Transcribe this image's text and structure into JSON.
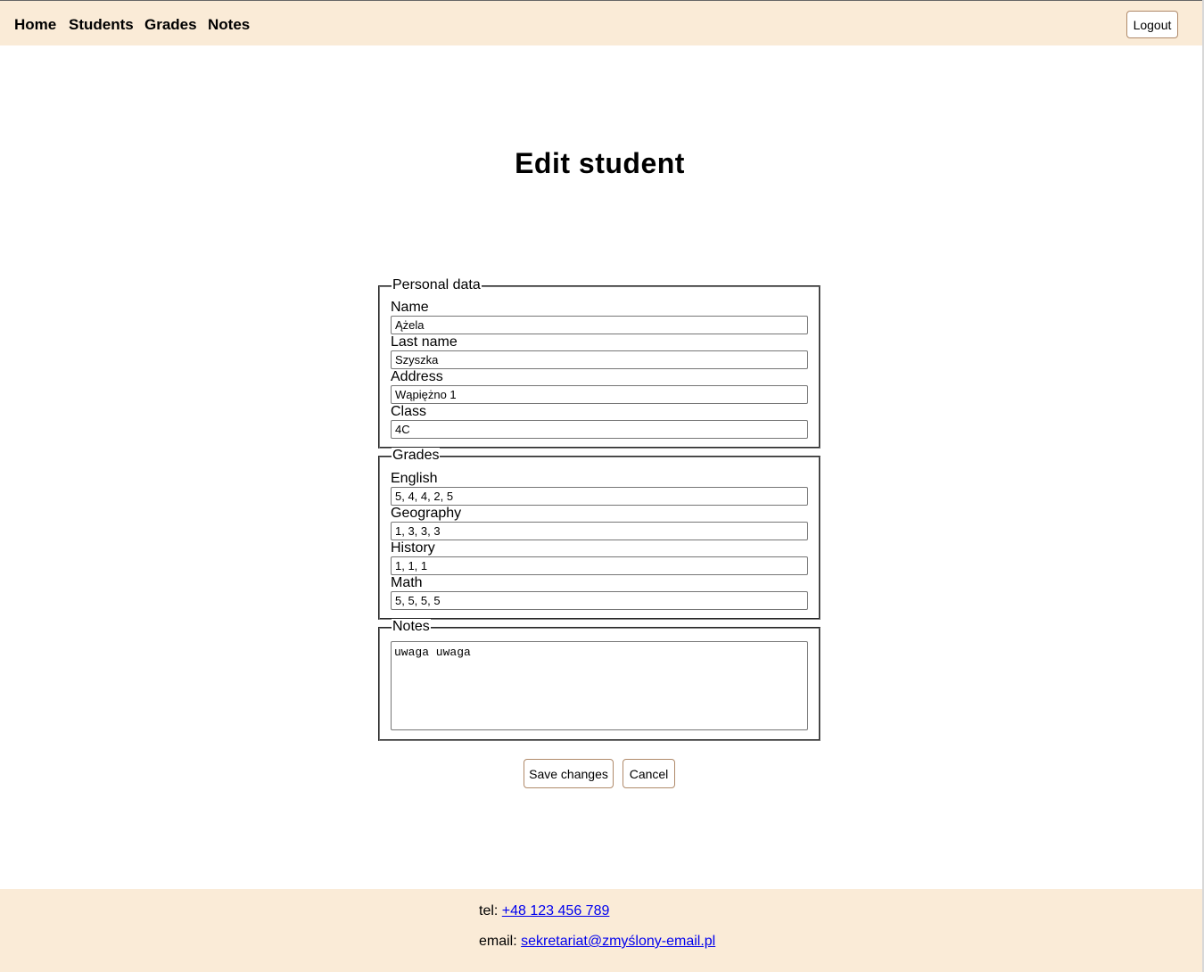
{
  "nav": {
    "items": [
      "Home",
      "Students",
      "Grades",
      "Notes"
    ],
    "logout_label": "Logout",
    "background_color": "#faebd7"
  },
  "page": {
    "title": "Edit student"
  },
  "personal_data": {
    "legend": "Personal data",
    "fields": [
      {
        "label": "Name",
        "value": "Ążela"
      },
      {
        "label": "Last name",
        "value": "Szyszka"
      },
      {
        "label": "Address",
        "value": "Wąpiężno 1"
      },
      {
        "label": "Class",
        "value": "4C"
      }
    ]
  },
  "grades": {
    "legend": "Grades",
    "fields": [
      {
        "label": "English",
        "value": "5, 4, 4, 2, 5"
      },
      {
        "label": "Geography",
        "value": "1, 3, 3, 3"
      },
      {
        "label": "History",
        "value": "1, 1, 1"
      },
      {
        "label": "Math",
        "value": "5, 5, 5, 5"
      }
    ]
  },
  "notes": {
    "legend": "Notes",
    "value": "uwaga uwaga"
  },
  "actions": {
    "save_label": "Save changes",
    "cancel_label": "Cancel",
    "button_border_color": "#b08a6a"
  },
  "footer": {
    "tel_label": "tel:",
    "tel_value": "+48 123 456 789",
    "email_label": "email:",
    "email_value": "sekretariat@zmyślony-email.pl",
    "link_color": "#0000ee"
  }
}
